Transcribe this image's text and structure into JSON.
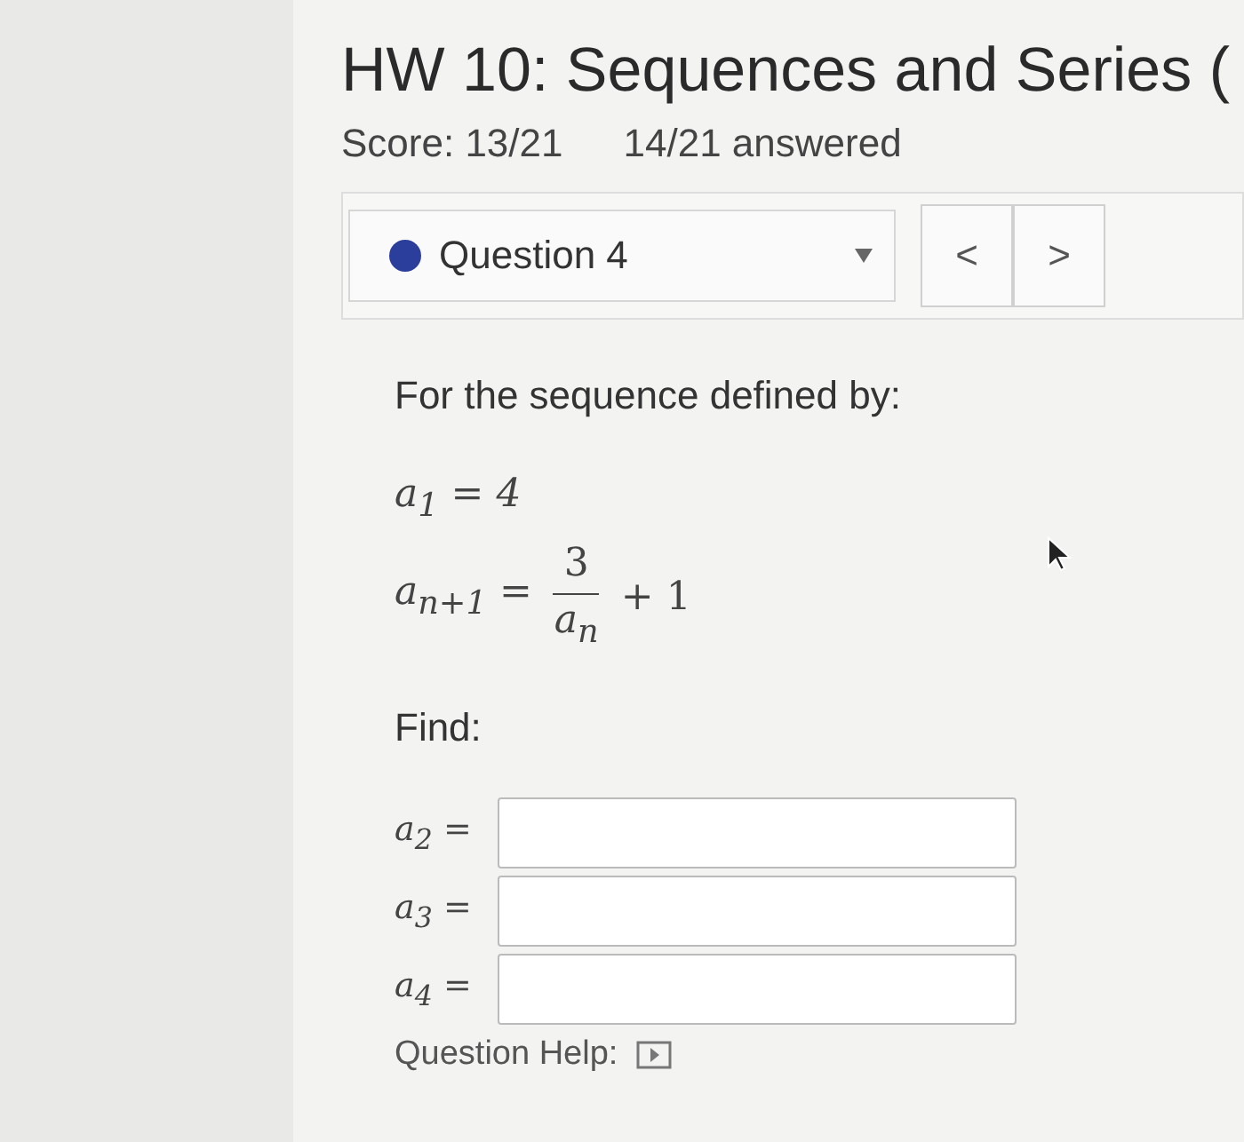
{
  "header": {
    "title": "HW 10: Sequences and Series (",
    "score": "Score: 13/21",
    "answered": "14/21 answered"
  },
  "question_nav": {
    "question": "Question 4",
    "prev": "<",
    "next": ">"
  },
  "question": {
    "prompt": "For the sequence defined by:",
    "definition": {
      "first": "a$_{1}$ = 4",
      "lhs": "a$_{n+1}$ =",
      "numerator": "3",
      "denominator": "a$_{n}$",
      "tail": "+ 1"
    },
    "find_label": "Find:",
    "answers": [
      {
        "label": "a$_{2}$ ="
      },
      {
        "label": "a$_{3}$ ="
      },
      {
        "label": "a$_{4}$ ="
      }
    ],
    "help_label": "Question Help:"
  }
}
